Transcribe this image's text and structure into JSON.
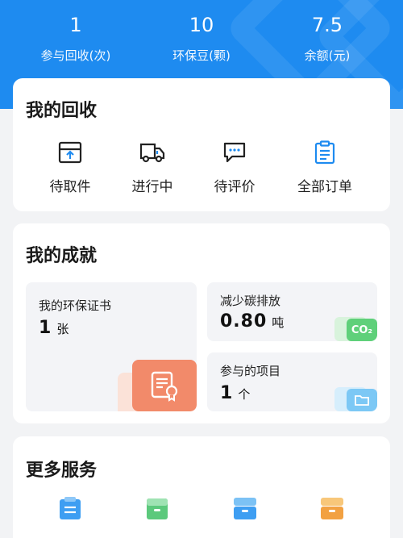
{
  "stats": [
    {
      "value": "1",
      "label": "参与回收(次)"
    },
    {
      "value": "10",
      "label": "环保豆(颗)"
    },
    {
      "value": "7.5",
      "label": "余额(元)"
    }
  ],
  "recycle": {
    "title": "我的回收",
    "items": [
      {
        "label": "待取件",
        "icon": "box-icon"
      },
      {
        "label": "进行中",
        "icon": "truck-icon"
      },
      {
        "label": "待评价",
        "icon": "chat-icon"
      },
      {
        "label": "全部订单",
        "icon": "clipboard-icon"
      }
    ]
  },
  "achievement": {
    "title": "我的成就",
    "certificate": {
      "title": "我的环保证书",
      "value": "1",
      "unit": "张"
    },
    "carbon": {
      "title": "减少碳排放",
      "value": "0.80",
      "unit": "吨",
      "badge": "CO₂"
    },
    "projects": {
      "title": "参与的项目",
      "value": "1",
      "unit": "个"
    }
  },
  "more": {
    "title": "更多服务",
    "icons": [
      "clipboard-icon",
      "box-icon",
      "drawer-icon",
      "drawer-icon"
    ]
  },
  "colors": {
    "brand_blue": "#1e8bf0",
    "icon_blue": "#1e8bf0",
    "orange": "#f28a6a",
    "green": "#5fd07a",
    "light_blue": "#7cc8f5"
  }
}
